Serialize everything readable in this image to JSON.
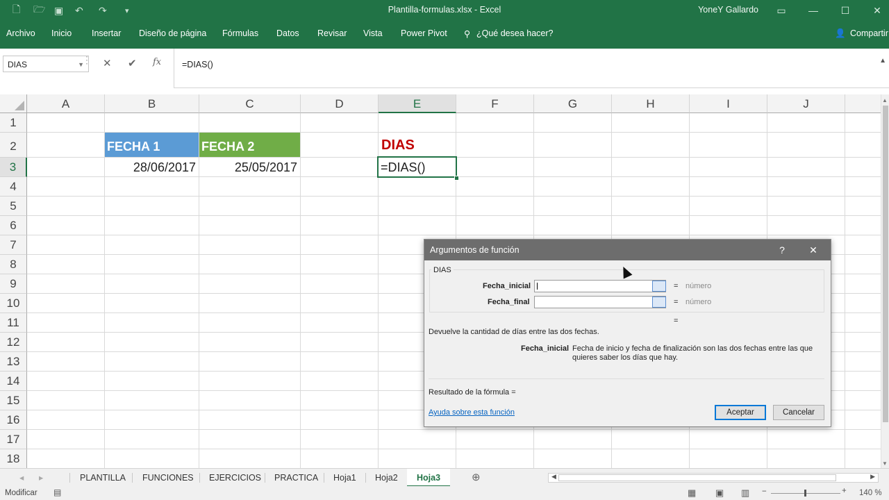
{
  "window": {
    "title": "Plantilla-formulas.xlsx  -  Excel",
    "user": "YoneY Gallardo"
  },
  "ribbon_tabs": [
    "Archivo",
    "Inicio",
    "Insertar",
    "Diseño de página",
    "Fórmulas",
    "Datos",
    "Revisar",
    "Vista",
    "Power Pivot",
    "¿Qué desea hacer?"
  ],
  "share_label": "Compartir",
  "formula_bar": {
    "name_box": "DIAS",
    "formula": "=DIAS()"
  },
  "grid": {
    "columns": [
      "A",
      "B",
      "C",
      "D",
      "E",
      "F",
      "G",
      "H",
      "I",
      "J"
    ],
    "selected_column": "E",
    "rows": [
      "1",
      "2",
      "3",
      "4",
      "5",
      "6",
      "7",
      "8",
      "9",
      "10",
      "11",
      "12",
      "13",
      "14",
      "15",
      "16",
      "17",
      "18"
    ],
    "selected_row": "3",
    "cells": {
      "B2": "FECHA 1",
      "C2": "FECHA 2",
      "E2": "DIAS",
      "B3": "28/06/2017",
      "C3": "25/05/2017",
      "E3": "=DIAS()"
    }
  },
  "colors": {
    "excel_green": "#217346",
    "header_b2": "#5b9bd5",
    "header_c2": "#70ad47",
    "dias_red": "#c00000"
  },
  "sheet_tabs": [
    "PLANTILLA",
    "FUNCIONES",
    "EJERCICIOS",
    "PRACTICA",
    "Hoja1",
    "Hoja2",
    "Hoja3"
  ],
  "active_sheet": "Hoja3",
  "status": {
    "mode": "Modificar",
    "zoom": "140 %"
  },
  "dialog": {
    "title": "Argumentos de función",
    "help_glyph": "?",
    "close_glyph": "✕",
    "function_name": "DIAS",
    "args": [
      {
        "label": "Fecha_inicial",
        "value": "",
        "eq": "=",
        "type": "número"
      },
      {
        "label": "Fecha_final",
        "value": "",
        "eq": "=",
        "type": "número"
      }
    ],
    "result_eq": "=",
    "description": "Devuelve la cantidad de días entre las dos fechas.",
    "arg_help_name": "Fecha_inicial",
    "arg_help_text": "Fecha de inicio y fecha de finalización son las dos fechas entre las que quieres saber los días que hay.",
    "result_label": "Resultado de la fórmula =",
    "help_link": "Ayuda sobre esta función",
    "ok_label": "Aceptar",
    "cancel_label": "Cancelar"
  }
}
